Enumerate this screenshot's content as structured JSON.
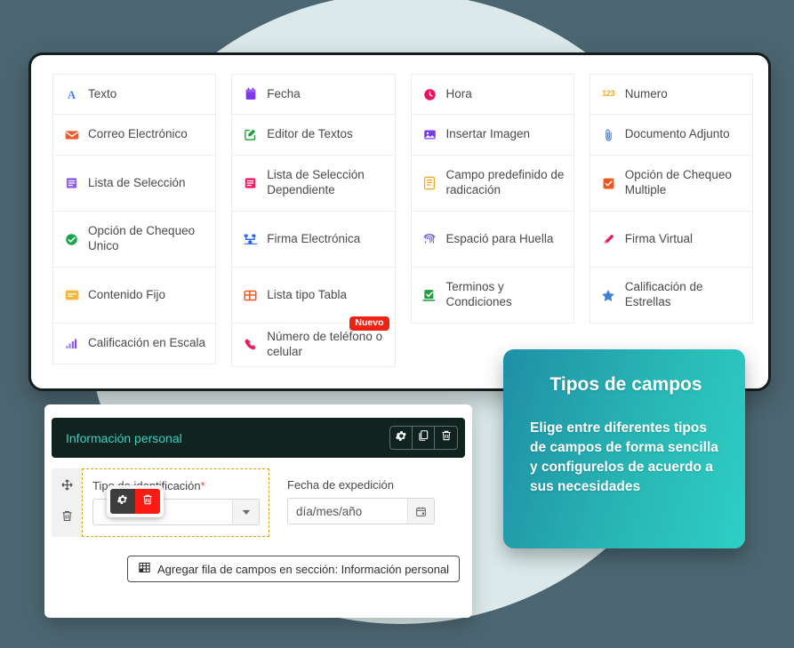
{
  "field_types": {
    "columns": [
      [
        {
          "label": "Texto",
          "icon": "letter-a-icon",
          "tall": false,
          "badge": null
        },
        {
          "label": "Correo Electrónico",
          "icon": "envelope-icon",
          "tall": false,
          "badge": null
        },
        {
          "label": "Lista de Selección",
          "icon": "list-select-icon",
          "tall": true,
          "badge": null
        },
        {
          "label": "Opción de Chequeo Unico",
          "icon": "radio-check-icon",
          "tall": true,
          "badge": null
        },
        {
          "label": "Contenido Fijo",
          "icon": "fixed-content-icon",
          "tall": true,
          "badge": null
        },
        {
          "label": "Calificación en Escala",
          "icon": "bar-scale-icon",
          "tall": false,
          "badge": null
        }
      ],
      [
        {
          "label": "Fecha",
          "icon": "calendar-icon",
          "tall": false,
          "badge": null
        },
        {
          "label": "Editor de Textos",
          "icon": "edit-square-icon",
          "tall": false,
          "badge": null
        },
        {
          "label": "Lista de Selección Dependiente",
          "icon": "list-dependent-icon",
          "tall": true,
          "badge": null
        },
        {
          "label": "Firma Electrónica",
          "icon": "signature-node-icon",
          "tall": true,
          "badge": null
        },
        {
          "label": "Lista tipo Tabla",
          "icon": "table-grid-icon",
          "tall": true,
          "badge": null
        },
        {
          "label": "Número de teléfono o celular",
          "icon": "phone-icon",
          "tall": false,
          "badge": "Nuevo"
        }
      ],
      [
        {
          "label": "Hora",
          "icon": "clock-icon",
          "tall": false,
          "badge": null
        },
        {
          "label": "Insertar Imagen",
          "icon": "image-icon",
          "tall": false,
          "badge": null
        },
        {
          "label": "Campo predefinido de radicación",
          "icon": "document-lines-icon",
          "tall": true,
          "badge": null
        },
        {
          "label": "Espació para Huella",
          "icon": "fingerprint-icon",
          "tall": true,
          "badge": null
        },
        {
          "label": "Terminos y Condiciones",
          "icon": "checkbox-terms-icon",
          "tall": true,
          "badge": null
        }
      ],
      [
        {
          "label": "Numero",
          "icon": "number-123-icon",
          "tall": false,
          "badge": null
        },
        {
          "label": "Documento Adjunto",
          "icon": "paperclip-icon",
          "tall": false,
          "badge": null
        },
        {
          "label": "Opción de Chequeo Multiple",
          "icon": "checkbox-multi-icon",
          "tall": true,
          "badge": null
        },
        {
          "label": "Firma Virtual",
          "icon": "pen-signature-icon",
          "tall": true,
          "badge": null
        },
        {
          "label": "Calificación de Estrellas",
          "icon": "star-icon",
          "tall": true,
          "badge": null
        }
      ]
    ]
  },
  "builder": {
    "section_title": "Información personal",
    "section_tools": [
      {
        "name": "settings",
        "icon": "gear-icon"
      },
      {
        "name": "duplicate",
        "icon": "copy-icon"
      },
      {
        "name": "delete",
        "icon": "trash-icon"
      }
    ],
    "row_handles": [
      {
        "name": "move",
        "icon": "move-arrows-icon"
      },
      {
        "name": "delete-row",
        "icon": "trash-icon"
      }
    ],
    "fields": [
      {
        "label": "Tipo de identificación",
        "required_mark": "*",
        "value": "",
        "adorn_icon": "chevron-down-icon",
        "selected": true
      },
      {
        "label": "Fecha de expedición",
        "required_mark": "",
        "value": "día/mes/año",
        "adorn_icon": "calendar-icon",
        "selected": false
      }
    ],
    "field_popover": [
      {
        "name": "configure-field",
        "icon": "gear-icon"
      },
      {
        "name": "delete-field",
        "icon": "trash-icon"
      }
    ],
    "add_row_label": "Agregar fila de campos en sección: Información personal",
    "add_row_icon": "table-grid-icon"
  },
  "callout": {
    "title": "Tipos de campos",
    "body": "Elige entre diferentes tipos de campos de forma sencilla y configurelos de acuerdo a sus necesidades"
  },
  "colors": {
    "page_background": "#4c6671",
    "circle": "#e7f4f4",
    "card_border": "#151d1f",
    "section_header": "#10231f",
    "section_title": "#37d2c4",
    "badge_new": "#f02214",
    "selected_dash": "#d1a319",
    "callout_from": "#1f8fa5",
    "callout_to": "#2ecfc4",
    "required": "#e8453c"
  }
}
